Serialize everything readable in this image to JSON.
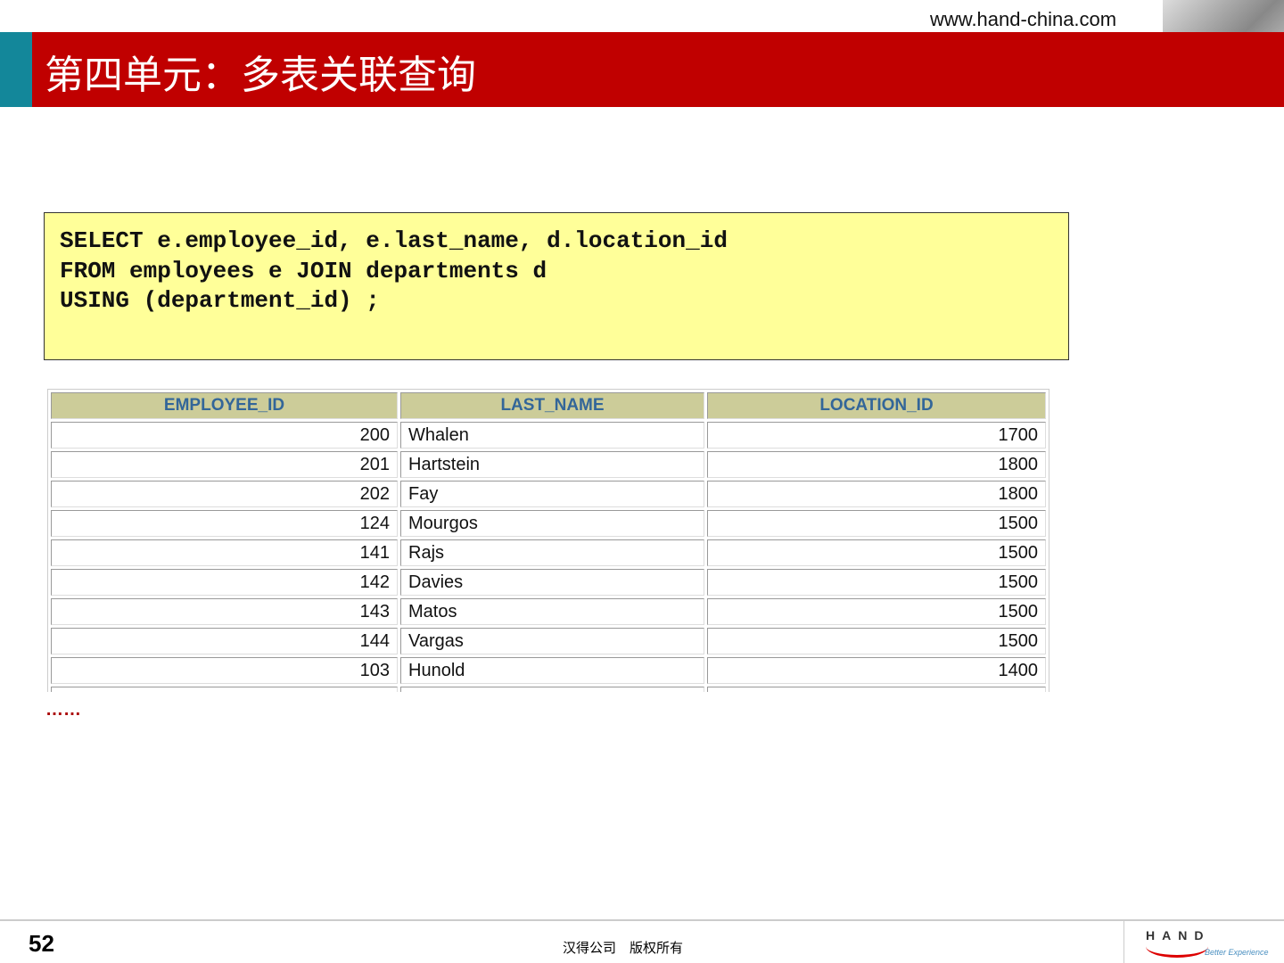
{
  "header": {
    "url": "www.hand-china.com",
    "title": "第四单元：多表关联查询"
  },
  "code": [
    "SELECT e.employee_id, e.last_name, d.location_id",
    "FROM employees e JOIN departments d",
    "USING (department_id) ;"
  ],
  "table": {
    "columns": [
      "EMPLOYEE_ID",
      "LAST_NAME",
      "LOCATION_ID"
    ],
    "rows": [
      [
        "200",
        "Whalen",
        "1700"
      ],
      [
        "201",
        "Hartstein",
        "1800"
      ],
      [
        "202",
        "Fay",
        "1800"
      ],
      [
        "124",
        "Mourgos",
        "1500"
      ],
      [
        "141",
        "Rajs",
        "1500"
      ],
      [
        "142",
        "Davies",
        "1500"
      ],
      [
        "143",
        "Matos",
        "1500"
      ],
      [
        "144",
        "Vargas",
        "1500"
      ],
      [
        "103",
        "Hunold",
        "1400"
      ],
      [
        "",
        "",
        ""
      ]
    ]
  },
  "ellipsis": "……",
  "footer": {
    "page": "52",
    "copyright": "汉得公司　版权所有",
    "logo": "HAND",
    "slogan": "Better Experience"
  }
}
